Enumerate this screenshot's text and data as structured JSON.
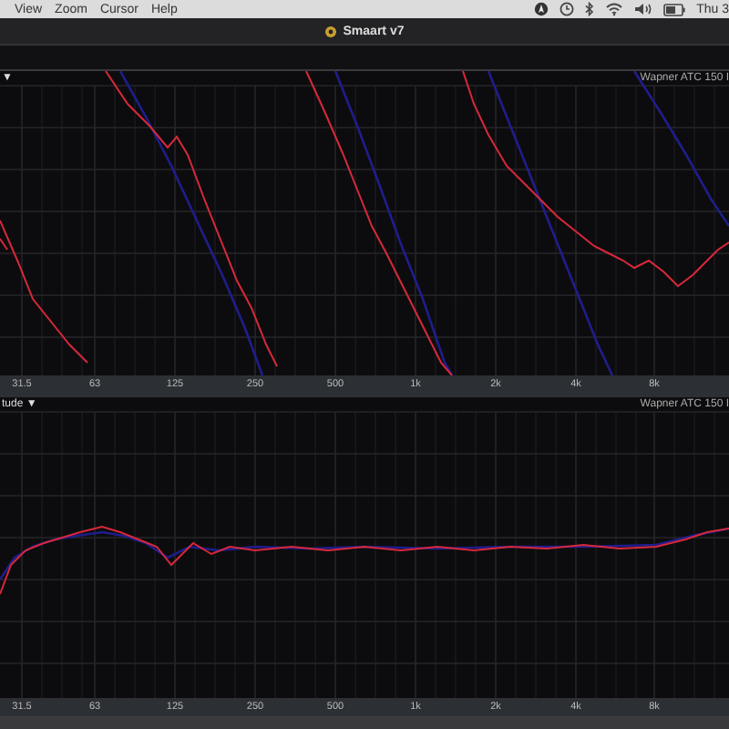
{
  "menu_bar": {
    "items": [
      "View",
      "Zoom",
      "Cursor",
      "Help"
    ],
    "clock": "Thu 3"
  },
  "window": {
    "title": "Smaart v7"
  },
  "plots": [
    {
      "kind": "phase",
      "header": "▼",
      "legend": "Wapner ATC 150 I",
      "axis_labels": [
        "31.5",
        "63",
        "125",
        "250",
        "500",
        "1k",
        "2k",
        "4k",
        "8k"
      ]
    },
    {
      "kind": "magnitude",
      "header": "tude ▼",
      "legend": "Wapner ATC 150 I",
      "axis_labels": [
        "31.5",
        "63",
        "125",
        "250",
        "500",
        "1k",
        "2k",
        "4k",
        "8k"
      ]
    }
  ]
}
